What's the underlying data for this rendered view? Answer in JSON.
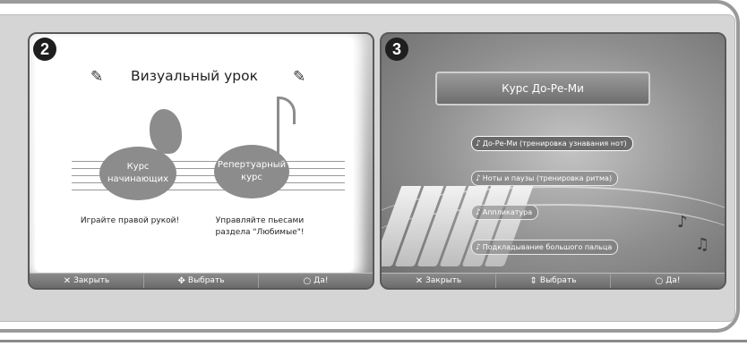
{
  "panel2": {
    "number": "2",
    "title": "Визуальный урок",
    "course1_label": "Курс начинающих",
    "course2_label": "Репертуарный курс",
    "caption1": "Играйте правой рукой!",
    "caption2": "Управляйте пьесами раздела \"Любимые\"!",
    "bar": {
      "close": "Закрыть",
      "select": "Выбрать",
      "ok": "Да!"
    }
  },
  "panel3": {
    "number": "3",
    "header": "Курс До-Ре-Ми",
    "menu": [
      "До-Ре-Ми (тренировка узнавания нот)",
      "Ноты и паузы (тренировка ритма)",
      "Аппликатура",
      "Подкладывание большого пальца"
    ],
    "bar": {
      "close": "Закрыть",
      "select": "Выбрать",
      "ok": "Да!"
    }
  },
  "icons": {
    "close": "x-icon",
    "select": "dpad-icon",
    "ok": "circle-icon",
    "note": "music-note-icon",
    "edit": "pencil-icon"
  }
}
